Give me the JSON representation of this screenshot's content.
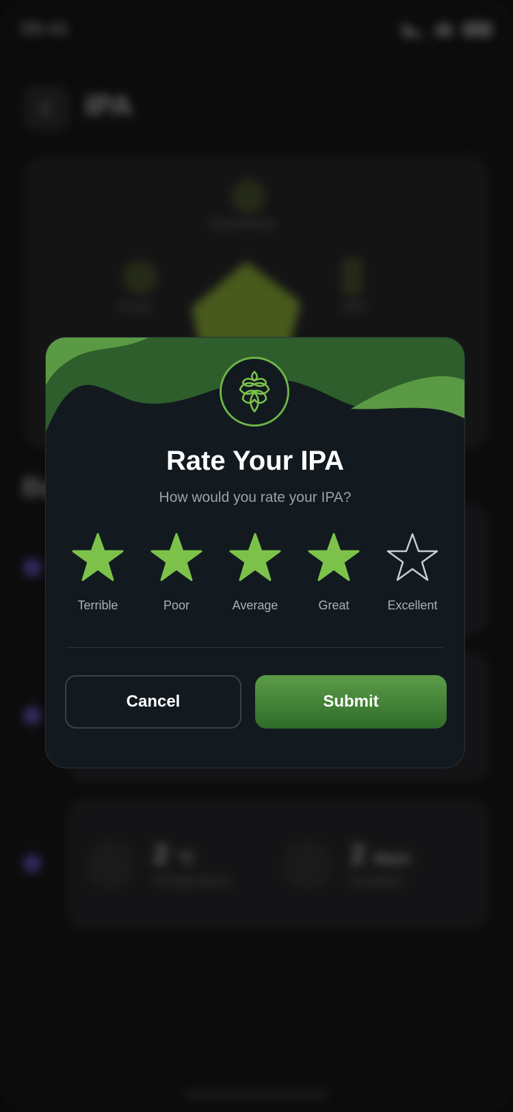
{
  "status": {
    "time": "09:41"
  },
  "background": {
    "title": "IPA",
    "radar_labels": {
      "top": "Sweetness",
      "left": "Fruity",
      "right": "ABV"
    },
    "section_heading": "Bo",
    "metrics": [
      {
        "value": "2",
        "unit": "°C",
        "label": "Temperature"
      },
      {
        "value": "2",
        "unit": "days",
        "label": "Duration"
      }
    ]
  },
  "modal": {
    "title": "Rate Your IPA",
    "subtitle": "How would you rate your IPA?",
    "rating": {
      "value": 4,
      "max": 5
    },
    "stars": [
      {
        "label": "Terrible",
        "filled": true
      },
      {
        "label": "Poor",
        "filled": true
      },
      {
        "label": "Average",
        "filled": true
      },
      {
        "label": "Great",
        "filled": true
      },
      {
        "label": "Excellent",
        "filled": false
      }
    ],
    "cancel_label": "Cancel",
    "submit_label": "Submit"
  },
  "colors": {
    "accent": "#7cc24a",
    "header_dark": "#2d5e2b",
    "header_light": "#5b9a44",
    "modal_bg": "#121a20"
  },
  "icons": {
    "badge": "hop-icon",
    "star_filled": "star-filled-icon",
    "star_empty": "star-outline-icon"
  }
}
